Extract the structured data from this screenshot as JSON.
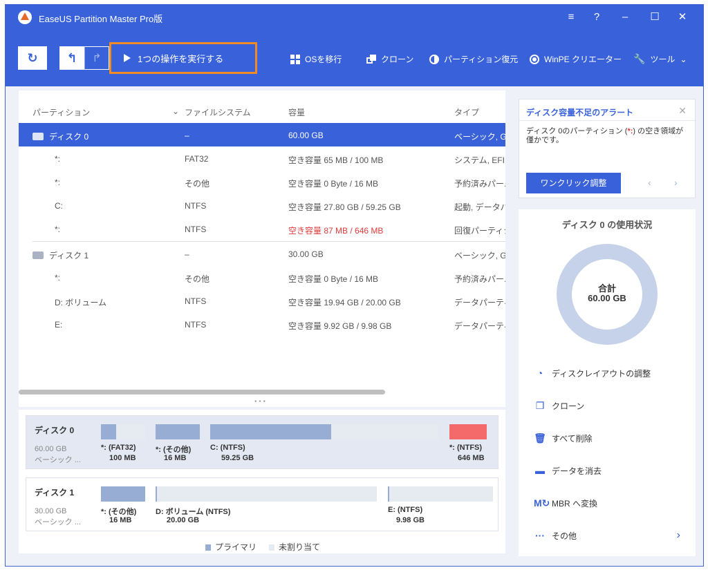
{
  "window": {
    "title": "EaseUS Partition Master Pro版"
  },
  "toolbar": {
    "execute_label": "1つの操作を実行する",
    "items": [
      "OSを移行",
      "クローン",
      "パーティション復元",
      "WinPE クリエーター",
      "ツール"
    ]
  },
  "table": {
    "headers": [
      "パーティション",
      "ファイルシステム",
      "容量",
      "タイプ"
    ],
    "rows": [
      {
        "name": "ディスク 0",
        "fs": "–",
        "cap": "60.00 GB",
        "type": "ベーシック, GPT",
        "disk": true,
        "selected": true
      },
      {
        "name": "*:",
        "fs": "FAT32",
        "cap": "空き容量 65 MB / 100 MB",
        "type": "システム, EFI..."
      },
      {
        "name": "*:",
        "fs": "その他",
        "cap": "空き容量 0 Byte / 16 MB",
        "type": "予約済みパー..."
      },
      {
        "name": "C:",
        "fs": "NTFS",
        "cap": "空き容量 27.80 GB / 59.25 GB",
        "type": "起動, データパ..."
      },
      {
        "name": "*:",
        "fs": "NTFS",
        "cap": "空き容量 87 MB / 646 MB",
        "type": "回復パーティシ...",
        "alert": true
      },
      {
        "name": "ディスク 1",
        "fs": "–",
        "cap": "30.00 GB",
        "type": "ベーシック, GPT",
        "disk": true
      },
      {
        "name": "*:",
        "fs": "その他",
        "cap": "空き容量 0 Byte / 16 MB",
        "type": "予約済みパー..."
      },
      {
        "name": "D: ボリューム",
        "fs": "NTFS",
        "cap": "空き容量 19.94 GB / 20.00 GB",
        "type": "データパーティ..."
      },
      {
        "name": "E:",
        "fs": "NTFS",
        "cap": "空き容量 9.92 GB / 9.98 GB",
        "type": "データパーティ..."
      }
    ]
  },
  "diskmap": {
    "disk0": {
      "name": "ディスク 0",
      "size": "60.00 GB",
      "type": "ベーシック ...",
      "parts": [
        {
          "label": "*: (FAT32)",
          "size": "100 MB"
        },
        {
          "label": "*: (その他)",
          "size": "16 MB"
        },
        {
          "label": "C: (NTFS)",
          "size": "59.25 GB"
        },
        {
          "label": "*: (NTFS)",
          "size": "646 MB"
        }
      ]
    },
    "disk1": {
      "name": "ディスク 1",
      "size": "30.00 GB",
      "type": "ベーシック ...",
      "parts": [
        {
          "label": "*: (その他)",
          "size": "16 MB"
        },
        {
          "label": "D: ボリューム (NTFS)",
          "size": "20.00 GB"
        },
        {
          "label": "E: (NTFS)",
          "size": "9.98 GB"
        }
      ]
    },
    "legend": [
      "プライマリ",
      "未割り当て"
    ]
  },
  "alert": {
    "title": "ディスク容量不足のアラート",
    "msg_pre": "ディスク 0のパーティション (",
    "msg_mark": "*:",
    "msg_post": ") の空き領域が僅かです。",
    "button": "ワンクリック調整"
  },
  "usage": {
    "title": "ディスク 0 の使用状況",
    "total_label": "合計",
    "total_value": "60.00 GB",
    "actions": [
      "ディスクレイアウトの調整",
      "クローン",
      "すべて削除",
      "データを消去",
      "MBR へ変換",
      "その他"
    ]
  },
  "colors": {
    "accent": "#3962da",
    "alert": "#e23a3a",
    "partition_fill": "#97add4",
    "danger_bar": "#f46a6a",
    "highlight": "#f08a24"
  }
}
